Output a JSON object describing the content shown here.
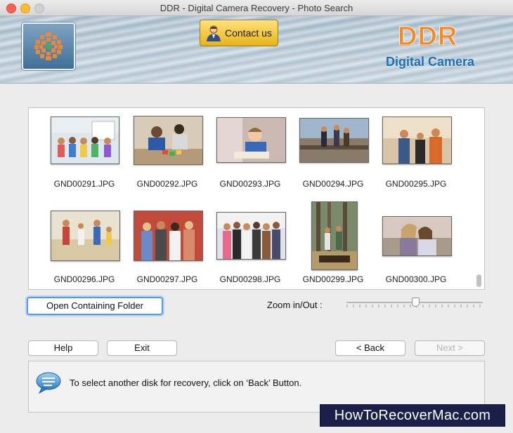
{
  "window": {
    "title": "DDR - Digital Camera Recovery - Photo Search"
  },
  "header": {
    "contact_label": "Contact us",
    "brand": "DDR",
    "product": "Digital Camera",
    "brand_color": "#f08a2a",
    "product_color": "#1f6fb0"
  },
  "gallery": {
    "files": [
      "GND00291.JPG",
      "GND00292.JPG",
      "GND00293.JPG",
      "GND00294.JPG",
      "GND00295.JPG",
      "GND00296.JPG",
      "GND00297.JPG",
      "GND00298.JPG",
      "GND00299.JPG",
      "GND00300.JPG"
    ]
  },
  "controls": {
    "open_folder": "Open Containing Folder",
    "zoom_label": "Zoom in/Out :",
    "zoom_level": 0.5,
    "help": "Help",
    "exit": "Exit",
    "back": "< Back",
    "next": "Next >"
  },
  "status": {
    "icon": "speech-bubble-icon",
    "message": "To select another disk for recovery, click on ‘Back’ Button."
  },
  "watermark": "HowToRecoverMac.com"
}
